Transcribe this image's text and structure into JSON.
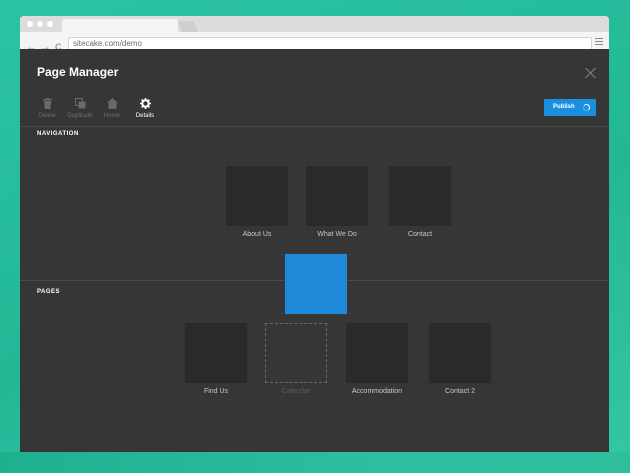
{
  "browser": {
    "url": "sitecake.com/demo",
    "back_icon": "←",
    "forward_icon": "→",
    "reload_icon": "C"
  },
  "app": {
    "title": "Page Manager",
    "toolbar": [
      {
        "label": "Delete",
        "icon": "trash-icon",
        "active": false
      },
      {
        "label": "Duplicate",
        "icon": "duplicate-icon",
        "active": false
      },
      {
        "label": "Home",
        "icon": "home-icon",
        "active": false
      },
      {
        "label": "Details",
        "icon": "gear-icon",
        "active": true
      }
    ],
    "publish_label": "Publish",
    "navigation_label": "NAVIGATION",
    "pages_label": "PAGES",
    "navigation_items": [
      "About Us",
      "What We Do",
      "Contact"
    ],
    "page_items": [
      "Find Us",
      "Calendar",
      "Accommodation",
      "Contact 2"
    ],
    "accent_color": "#1a8fdf"
  }
}
